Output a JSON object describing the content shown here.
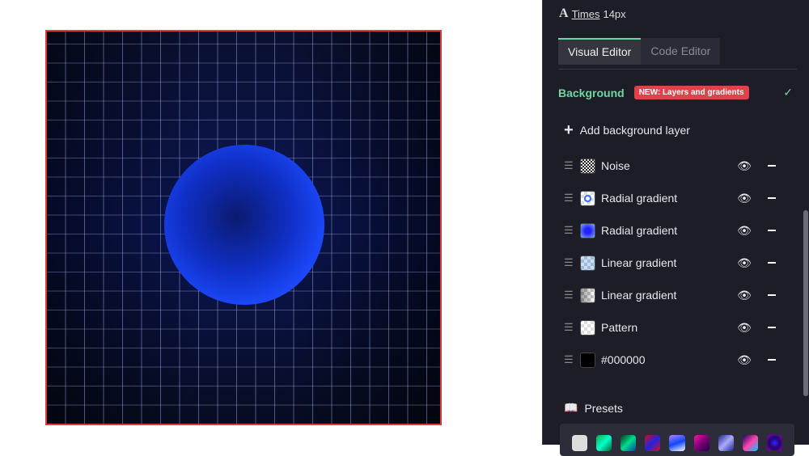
{
  "font": {
    "name": "Times",
    "size": "14px"
  },
  "tabs": [
    {
      "label": "Visual Editor",
      "active": true
    },
    {
      "label": "Code Editor",
      "active": false
    }
  ],
  "background": {
    "title": "Background",
    "badge": "NEW: Layers and gradients",
    "add_label": "Add background layer",
    "layers": [
      {
        "name": "Noise",
        "icon": "noise-thumb"
      },
      {
        "name": "Radial gradient",
        "icon": "radial-thumb"
      },
      {
        "name": "Radial gradient",
        "icon": "radial-blue-thumb"
      },
      {
        "name": "Linear gradient",
        "icon": "linear-blue-thumb"
      },
      {
        "name": "Linear gradient",
        "icon": "linear-gray-thumb"
      },
      {
        "name": "Pattern",
        "icon": "pattern-thumb"
      },
      {
        "name": "#000000",
        "icon": "color-thumb"
      }
    ]
  },
  "presets": {
    "label": "Presets"
  },
  "colors": {
    "accent": "#6fd7a0",
    "badge": "#e0424a",
    "panel": "#1c1d27",
    "canvas_border": "#e03a3a"
  }
}
